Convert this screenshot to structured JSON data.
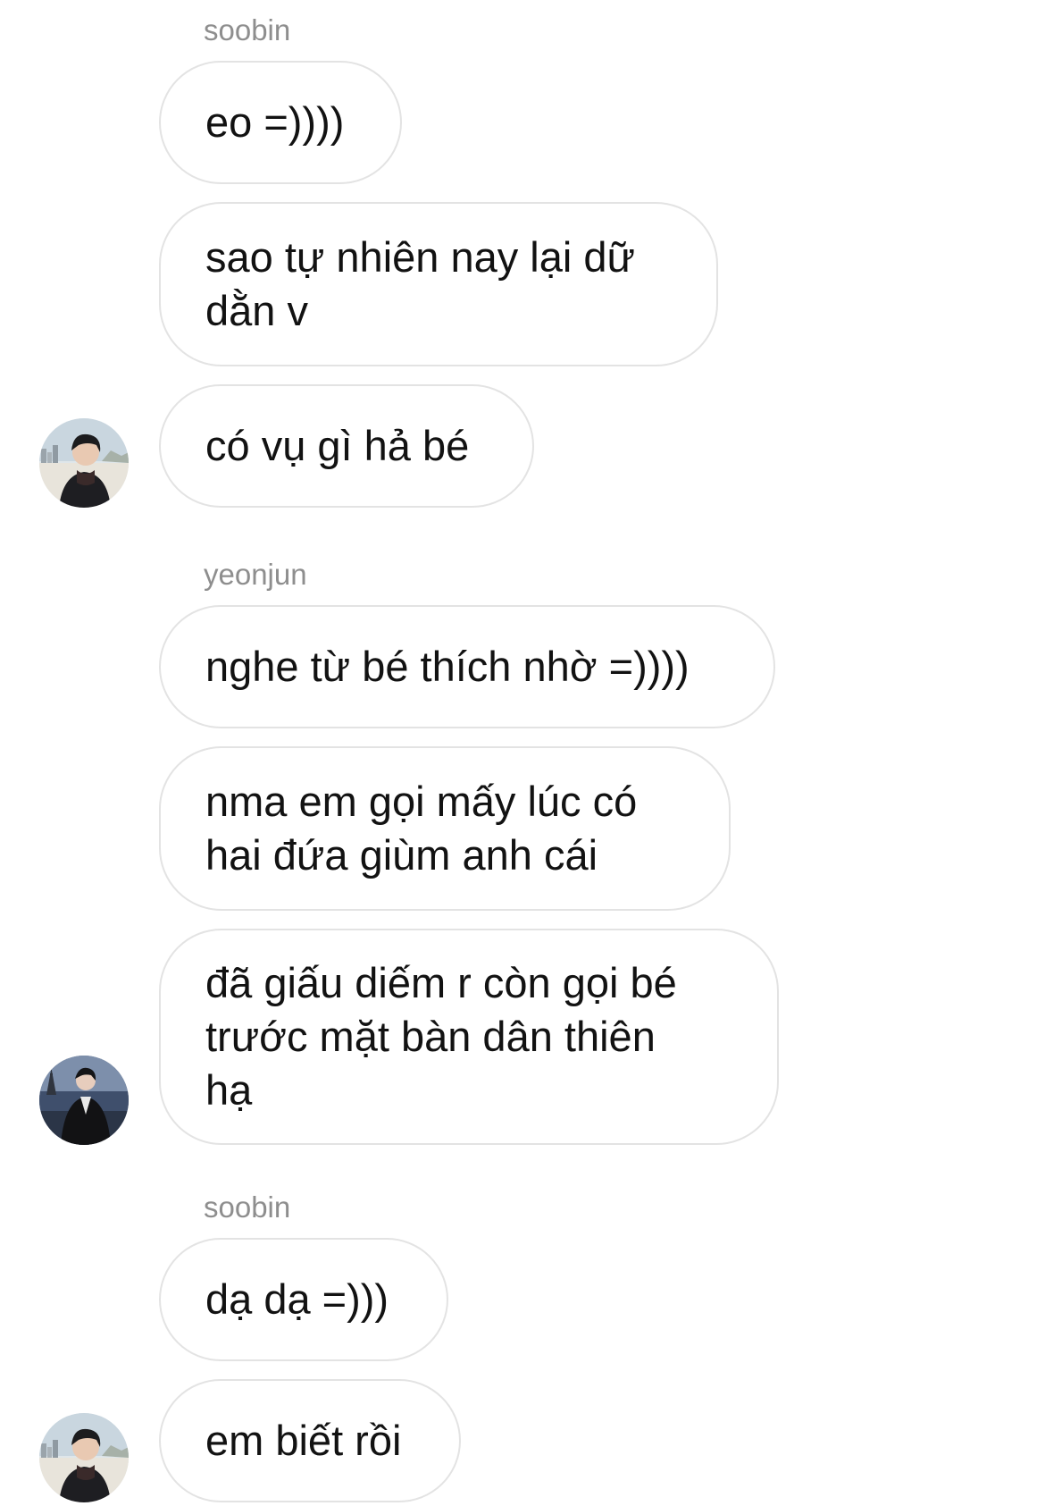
{
  "conversation": {
    "groups": [
      {
        "sender": "soobin",
        "messages": [
          "eo =))))",
          "sao tự nhiên nay lại dữ\ndằn v",
          "có vụ gì hả bé"
        ]
      },
      {
        "sender": "yeonjun",
        "messages": [
          "nghe từ bé thích nhờ =))))",
          "nma em gọi mấy lúc có\nhai đứa giùm anh cái",
          "đã giấu diếm r còn gọi bé\ntrước mặt bàn dân thiên\nhạ"
        ]
      },
      {
        "sender": "soobin",
        "messages": [
          "dạ dạ =)))",
          "em biết rồi"
        ]
      }
    ]
  },
  "colors": {
    "background": "#ffffff",
    "bubble_border": "#e3e3e3",
    "sender_text": "#8e8e8e",
    "message_text": "#121212"
  },
  "icons": {
    "soobin_avatar": "profile-photo-beach",
    "yeonjun_avatar": "profile-photo-river-night"
  }
}
